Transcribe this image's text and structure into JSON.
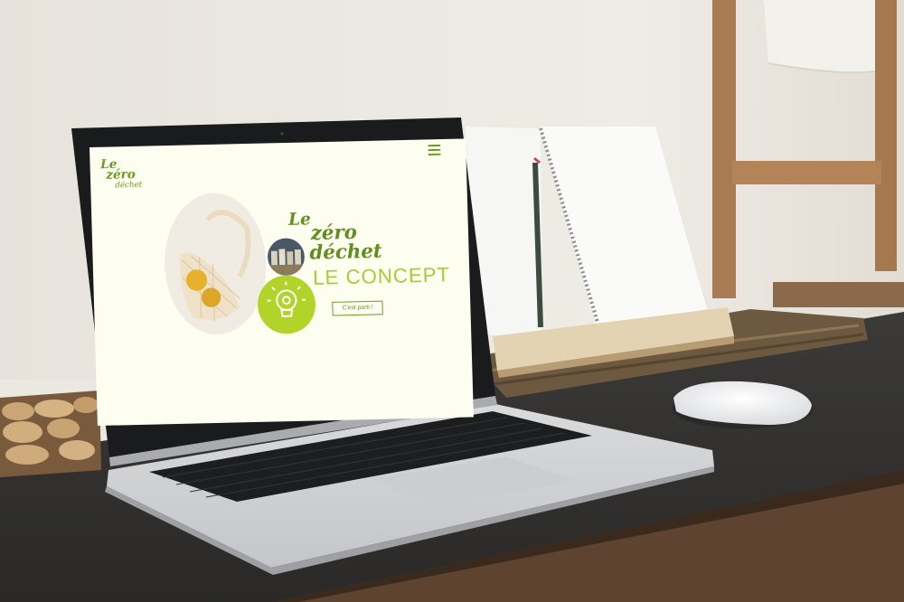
{
  "screen": {
    "logo": {
      "line1": "Le",
      "line2": "zéro",
      "line3": "déchet"
    },
    "hero": {
      "title_le": "Le",
      "title_zero": "zéro",
      "title_dechet": "déchet",
      "subtitle": "LE CONCEPT",
      "cta_label": "C'est parti !"
    },
    "menu": {
      "icon": "hamburger-menu-icon"
    },
    "icons": {
      "idea": "lightbulb-gear-icon"
    }
  },
  "colors": {
    "screen_bg": "#fdfef0",
    "brand_green": "#6b9a26",
    "lime": "#b2d42a"
  }
}
